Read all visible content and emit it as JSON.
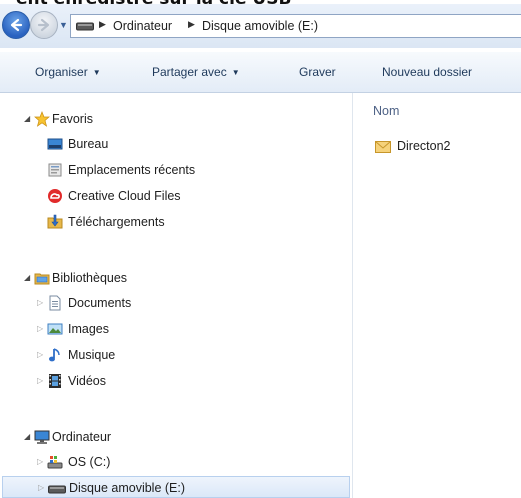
{
  "cut_heading": "ent enregistré sur la clé USB",
  "address_bar": {
    "crumbs": [
      "Ordinateur",
      "Disque amovible (E:)"
    ]
  },
  "toolbar": {
    "organize": "Organiser",
    "share": "Partager avec",
    "burn": "Graver",
    "new_folder": "Nouveau dossier"
  },
  "nav": {
    "favorites": {
      "label": "Favoris",
      "items": [
        "Bureau",
        "Emplacements récents",
        "Creative Cloud Files",
        "Téléchargements"
      ]
    },
    "libraries": {
      "label": "Bibliothèques",
      "items": [
        "Documents",
        "Images",
        "Musique",
        "Vidéos"
      ]
    },
    "computer": {
      "label": "Ordinateur",
      "items": [
        "OS (C:)",
        "Disque amovible (E:)"
      ]
    }
  },
  "content": {
    "column_name": "Nom",
    "files": [
      {
        "name": "Directon2",
        "icon": "envelope-icon"
      }
    ]
  },
  "colors": {
    "accent": "#2a62c0",
    "selection": "#dbe8f8",
    "toolbar_text": "#1e395b"
  }
}
